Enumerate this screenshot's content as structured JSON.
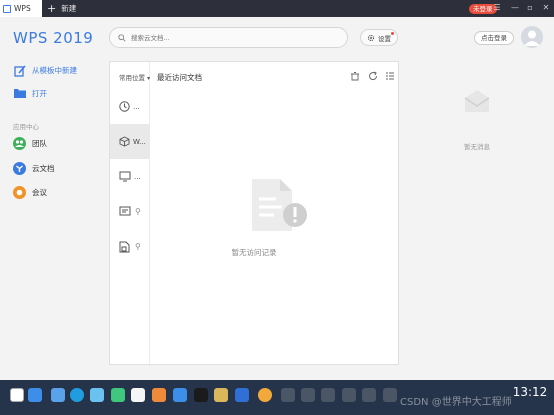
{
  "titlebar": {
    "app_tab": "WPS",
    "new_tab": "新建",
    "login_badge": "未登录"
  },
  "brand": "WPS 2019",
  "search": {
    "placeholder": "搜索云文档..."
  },
  "settings_label": "设置",
  "login_button": "点击登录",
  "sidebar": {
    "new_from_template": "从模板中新建",
    "open": "打开",
    "section_label": "应用中心",
    "items": [
      "团队",
      "云文档",
      "会议"
    ]
  },
  "panel": {
    "left_header": "常用位置",
    "rows": [
      "...",
      "W...",
      "...",
      "",
      ""
    ],
    "recent_title": "最近访问文档",
    "empty_text": "暂无访问记录"
  },
  "messages": {
    "empty_text": "暂无消息"
  },
  "taskbar": {
    "clock": "13:12",
    "watermark": "CSDN @世界中大工程师"
  },
  "colors": {
    "accent": "#3b7be0",
    "titlebar": "#2d2f3a",
    "badge": "#e84c3d",
    "taskbar": "#25344a"
  }
}
